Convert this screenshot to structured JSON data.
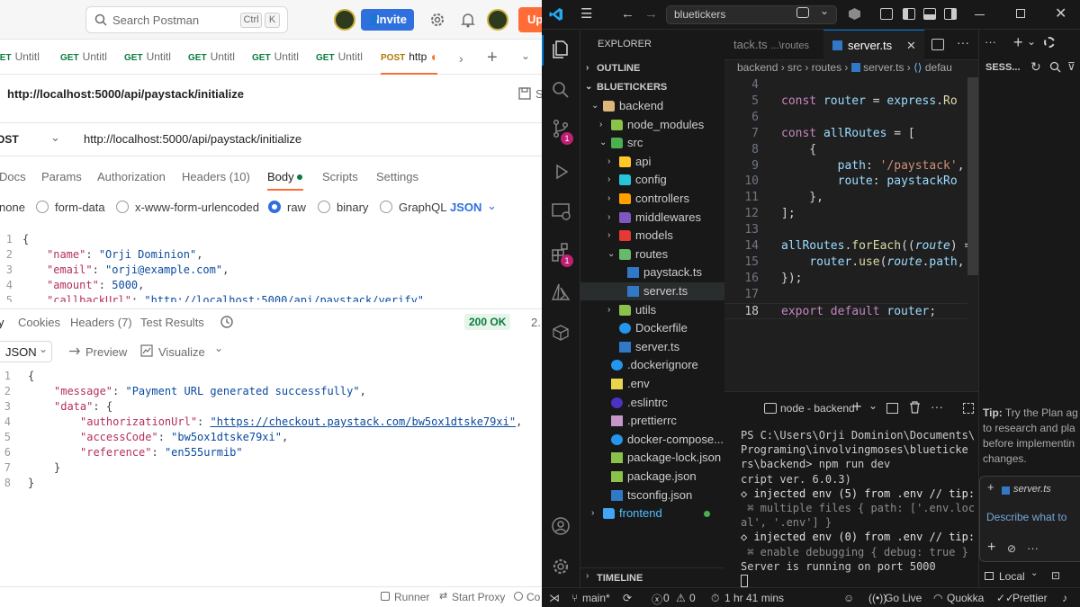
{
  "postman": {
    "search_placeholder": "Search Postman",
    "search_keys": [
      "Ctrl",
      "K"
    ],
    "invite_label": "Invite",
    "upgrade_label": "Up",
    "tabs": [
      {
        "method": "GET",
        "label": "Untitl"
      },
      {
        "method": "GET",
        "label": "Untitl"
      },
      {
        "method": "GET",
        "label": "Untitl"
      },
      {
        "method": "GET",
        "label": "Untitl"
      },
      {
        "method": "GET",
        "label": "Untitl"
      },
      {
        "method": "GET",
        "label": "Untitl"
      },
      {
        "method": "POST",
        "label": "http"
      }
    ],
    "request_title": "http://localhost:5000/api/paystack/initialize",
    "save_label": "S",
    "method": "OST",
    "url": "http://localhost:5000/api/paystack/initialize",
    "subtabs": [
      "Docs",
      "Params",
      "Authorization",
      "Headers (10)",
      "Body",
      "Scripts",
      "Settings"
    ],
    "body_types": [
      "none",
      "form-data",
      "x-www-form-urlencoded",
      "raw",
      "binary",
      "GraphQL"
    ],
    "body_format": "JSON",
    "body_lines": [
      {
        "n": "1",
        "text": "{"
      },
      {
        "n": "2",
        "key": "\"name\"",
        "val": "\"Orji Dominion\"",
        "end": ","
      },
      {
        "n": "3",
        "key": "\"email\"",
        "val": "\"orji@example.com\"",
        "end": ","
      },
      {
        "n": "4",
        "key": "\"amount\"",
        "val": "5000",
        "end": ","
      },
      {
        "n": "5",
        "key": "\"callbackUrl\"",
        "val": "\"http://localhost:5000/api/paystack/verify\"",
        "end": ""
      }
    ],
    "response_tabs": [
      "y",
      "Cookies",
      "Headers (7)",
      "Test Results"
    ],
    "status": "200 OK",
    "status_extra": "2.",
    "response_format": "JSON",
    "preview_label": "Preview",
    "visualize_label": "Visualize",
    "response_lines": [
      {
        "n": "1",
        "text": "{"
      },
      {
        "n": "2",
        "key": "\"message\"",
        "val": "\"Payment URL generated successfully\"",
        "end": ","
      },
      {
        "n": "3",
        "key": "\"data\"",
        "val": "{",
        "end": ""
      },
      {
        "n": "4",
        "key": "\"authorizationUrl\"",
        "val": "\"https://checkout.paystack.com/bw5ox1dtske79xi\"",
        "end": ","
      },
      {
        "n": "5",
        "key": "\"accessCode\"",
        "val": "\"bw5ox1dtske79xi\"",
        "end": ","
      },
      {
        "n": "6",
        "key": "\"reference\"",
        "val": "\"en555urmib\"",
        "end": ""
      },
      {
        "n": "7",
        "text": "}"
      },
      {
        "n": "8",
        "text": "}"
      }
    ],
    "footer": [
      "Runner",
      "Start Proxy",
      "Co"
    ]
  },
  "vscode": {
    "command_center": "bluetickers",
    "explorer_title": "EXPLORER",
    "outline_label": "OUTLINE",
    "root_label": "BLUETICKERS",
    "timeline_label": "TIMELINE",
    "tree": [
      {
        "label": "backend",
        "depth": 0,
        "kind": "folder",
        "open": true,
        "color": "#dcb67a"
      },
      {
        "label": "node_modules",
        "depth": 1,
        "kind": "folder",
        "open": false,
        "color": "#8bc34a"
      },
      {
        "label": "src",
        "depth": 1,
        "kind": "folder",
        "open": true,
        "color": "#4caf50"
      },
      {
        "label": "api",
        "depth": 2,
        "kind": "folder",
        "open": false,
        "color": "#ffca28"
      },
      {
        "label": "config",
        "depth": 2,
        "kind": "folder",
        "open": false,
        "color": "#26c6da"
      },
      {
        "label": "controllers",
        "depth": 2,
        "kind": "folder",
        "open": false,
        "color": "#ffa000"
      },
      {
        "label": "middlewares",
        "depth": 2,
        "kind": "folder",
        "open": false,
        "color": "#7e57c2"
      },
      {
        "label": "models",
        "depth": 2,
        "kind": "folder",
        "open": false,
        "color": "#e53935"
      },
      {
        "label": "routes",
        "depth": 2,
        "kind": "folder",
        "open": true,
        "color": "#66bb6a"
      },
      {
        "label": "paystack.ts",
        "depth": 3,
        "kind": "ts",
        "color": "#3178c6"
      },
      {
        "label": "server.ts",
        "depth": 3,
        "kind": "ts",
        "color": "#3178c6",
        "selected": true
      },
      {
        "label": "utils",
        "depth": 2,
        "kind": "folder",
        "open": false,
        "color": "#8bc34a"
      },
      {
        "label": "Dockerfile",
        "depth": 2,
        "kind": "docker",
        "color": "#2496ed"
      },
      {
        "label": "server.ts",
        "depth": 2,
        "kind": "ts",
        "color": "#3178c6"
      },
      {
        "label": ".dockerignore",
        "depth": 1,
        "kind": "docker",
        "color": "#2496ed"
      },
      {
        "label": ".env",
        "depth": 1,
        "kind": "env",
        "color": "#e8d44d"
      },
      {
        "label": ".eslintrc",
        "depth": 1,
        "kind": "eslint",
        "color": "#4b32c3"
      },
      {
        "label": ".prettierrc",
        "depth": 1,
        "kind": "prettier",
        "color": "#c596c7"
      },
      {
        "label": "docker-compose....",
        "depth": 1,
        "kind": "docker",
        "color": "#2496ed"
      },
      {
        "label": "package-lock.json",
        "depth": 1,
        "kind": "json",
        "color": "#8bc34a"
      },
      {
        "label": "package.json",
        "depth": 1,
        "kind": "json",
        "color": "#8bc34a"
      },
      {
        "label": "tsconfig.json",
        "depth": 1,
        "kind": "ts",
        "color": "#3178c6"
      },
      {
        "label": "frontend",
        "depth": 0,
        "kind": "folder",
        "open": false,
        "color": "#42a5f5"
      }
    ],
    "editor_tabs": [
      {
        "label": "tack.ts",
        "desc": "...\\routes"
      },
      {
        "label": "server.ts",
        "active": true
      }
    ],
    "breadcrumb": [
      "backend",
      "src",
      "routes",
      "server.ts",
      "defau"
    ],
    "code": [
      {
        "n": "4",
        "parts": []
      },
      {
        "n": "5",
        "parts": [
          [
            "kw",
            "const "
          ],
          [
            "var",
            "router"
          ],
          [
            "pl",
            " = "
          ],
          [
            "var",
            "express"
          ],
          [
            "pl",
            "."
          ],
          [
            "fn",
            "Ro"
          ]
        ]
      },
      {
        "n": "6",
        "parts": []
      },
      {
        "n": "7",
        "parts": [
          [
            "kw",
            "const "
          ],
          [
            "var",
            "allRoutes"
          ],
          [
            "pl",
            " = ["
          ]
        ]
      },
      {
        "n": "8",
        "parts": [
          [
            "pl",
            "    {"
          ]
        ]
      },
      {
        "n": "9",
        "parts": [
          [
            "pl",
            "        "
          ],
          [
            "var",
            "path"
          ],
          [
            "pl",
            ": "
          ],
          [
            "sq",
            "'/paystack'"
          ],
          [
            "pl",
            ","
          ]
        ]
      },
      {
        "n": "10",
        "parts": [
          [
            "pl",
            "        "
          ],
          [
            "var",
            "route"
          ],
          [
            "pl",
            ": "
          ],
          [
            "var",
            "paystackRo"
          ]
        ]
      },
      {
        "n": "11",
        "parts": [
          [
            "pl",
            "    },"
          ]
        ]
      },
      {
        "n": "12",
        "parts": [
          [
            "pl",
            "];"
          ]
        ]
      },
      {
        "n": "13",
        "parts": []
      },
      {
        "n": "14",
        "parts": [
          [
            "var",
            "allRoutes"
          ],
          [
            "pl",
            "."
          ],
          [
            "fn",
            "forEach"
          ],
          [
            "pl",
            "(("
          ],
          [
            "pr",
            "route"
          ],
          [
            "pl",
            ") =>"
          ]
        ]
      },
      {
        "n": "15",
        "parts": [
          [
            "pl",
            "    "
          ],
          [
            "var",
            "router"
          ],
          [
            "pl",
            "."
          ],
          [
            "fn",
            "use"
          ],
          [
            "pl",
            "("
          ],
          [
            "pr",
            "route"
          ],
          [
            "pl",
            "."
          ],
          [
            "var",
            "path"
          ],
          [
            "pl",
            ", r"
          ]
        ]
      },
      {
        "n": "16",
        "parts": [
          [
            "pl",
            "});"
          ]
        ]
      },
      {
        "n": "17",
        "parts": []
      },
      {
        "n": "18",
        "parts": [
          [
            "kw",
            "export default "
          ],
          [
            "var",
            "router"
          ],
          [
            "pl",
            ";"
          ]
        ]
      }
    ],
    "terminal_name": "node - backend",
    "terminal_lines": [
      "PS C:\\Users\\Orji Dominion\\Documents\\",
      "Programing\\involvingmoses\\blueticke",
      "rs\\backend> npm run dev",
      "cript ver. 6.0.3)",
      "◇ injected env (5) from .env // tip:",
      " ⌘ multiple files { path: ['.env.loc",
      "al', '.env'] }",
      "◇ injected env (0) from .env // tip:",
      " ⌘ enable debugging { debug: true }",
      "Server is running on port 5000"
    ],
    "chat": {
      "title": "SESS...",
      "tip_prefix": "Tip:",
      "tip_lines": [
        "Try the Plan ag",
        "to research and pla",
        "before implementin",
        "changes."
      ],
      "context_file": "server.ts",
      "input_placeholder": "Describe what to",
      "mode_label": "Local"
    },
    "status": {
      "branch": "main*",
      "errors": "0",
      "warnings": "0",
      "time": "1 hr 41 mins",
      "golive": "Go Live",
      "quokka": "Quokka",
      "prettier": "Prettier"
    },
    "badges": [
      "1",
      "1"
    ]
  }
}
